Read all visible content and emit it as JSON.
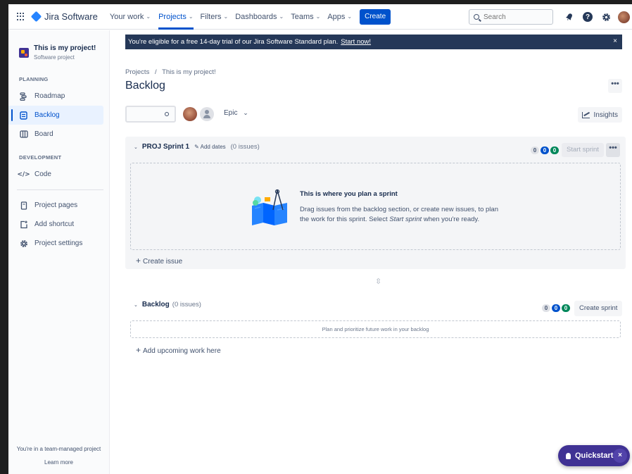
{
  "topnav": {
    "product_name": "Jira Software",
    "items": [
      {
        "label": "Your work",
        "chevron": "⌄"
      },
      {
        "label": "Projects",
        "chevron": "⌄"
      },
      {
        "label": "Filters",
        "chevron": "⌄"
      },
      {
        "label": "Dashboards",
        "chevron": "⌄"
      },
      {
        "label": "Teams",
        "chevron": "⌄"
      },
      {
        "label": "Apps",
        "chevron": "⌄"
      }
    ],
    "create_label": "Create",
    "search_placeholder": "Search",
    "icons": [
      "apps-grid-icon",
      "jira-logo-icon",
      "notifications-icon",
      "help-icon",
      "settings-icon",
      "user-avatar"
    ]
  },
  "sidebar": {
    "project_name": "This is my project!",
    "project_type": "Software project",
    "planning_title": "PLANNING",
    "planning_items": [
      {
        "label": "Roadmap",
        "icon": "roadmap-icon",
        "glyph": "☰"
      },
      {
        "label": "Backlog",
        "icon": "backlog-icon",
        "glyph": "☰"
      },
      {
        "label": "Board",
        "icon": "board-icon",
        "glyph": "▥"
      }
    ],
    "development_title": "DEVELOPMENT",
    "development_items": [
      {
        "label": "Code",
        "icon": "code-icon",
        "glyph": "</>"
      }
    ],
    "other_items": [
      {
        "label": "Project pages",
        "icon": "pages-icon",
        "glyph": "▯"
      },
      {
        "label": "Add shortcut",
        "icon": "add-shortcut-icon",
        "glyph": "⊡"
      },
      {
        "label": "Project settings",
        "icon": "settings-icon",
        "glyph": "⚙"
      }
    ],
    "footer_text": "You're in a team-managed project",
    "footer_link": "Learn more"
  },
  "banner": {
    "text": "You're eligible for a free 14-day trial of our Jira Software Standard plan.",
    "link": "Start now!",
    "close": "×"
  },
  "breadcrumb": {
    "root": "Projects",
    "separator": "/",
    "current": "This is my project!"
  },
  "page": {
    "title": "Backlog",
    "more": "•••"
  },
  "toolbar": {
    "epic_label": "Epic",
    "epic_chevron": "⌄",
    "insights_label": "Insights"
  },
  "sprint": {
    "caret": "⌄",
    "name": "PROJ Sprint 1",
    "add_dates": "✎ Add dates",
    "issue_count": "(0 issues)",
    "counts": {
      "todo": "0",
      "in_progress": "0",
      "done": "0"
    },
    "start_label": "Start sprint",
    "more": "•••",
    "empty_title": "This is where you plan a sprint",
    "empty_desc_1": "Drag issues from the backlog section, or create new issues, to plan the work for this sprint. Select ",
    "empty_desc_em": "Start sprint",
    "empty_desc_2": " when you're ready.",
    "create_issue": "Create issue"
  },
  "drag_handle": "⇳",
  "backlog": {
    "caret": "⌄",
    "name": "Backlog",
    "issue_count": "(0 issues)",
    "counts": {
      "todo": "0",
      "in_progress": "0",
      "done": "0"
    },
    "create_sprint": "Create sprint",
    "empty_text": "Plan and prioritize future work in your backlog",
    "add_upcoming": "Add upcoming work here"
  },
  "quickstart": {
    "label": "Quickstart",
    "close": "×"
  },
  "colors": {
    "primary": "#0052cc",
    "banner": "#253858",
    "quickstart": "#403294",
    "done_badge": "#00875a"
  }
}
